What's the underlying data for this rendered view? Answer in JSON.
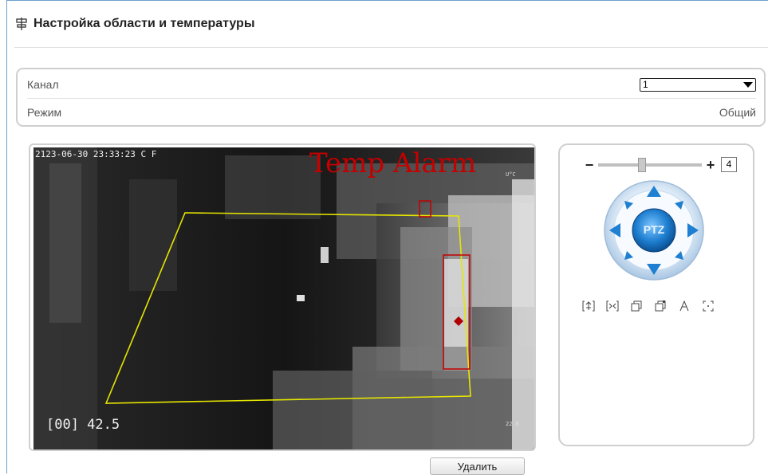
{
  "page": {
    "title": "Настройка области и температуры"
  },
  "settings": {
    "channel_label": "Канал",
    "channel_value": "1",
    "mode_label": "Режим",
    "mode_value": "Общий"
  },
  "video": {
    "timestamp": "2123-06-30 23:33:23 C F",
    "alarm_text": "Temp Alarm",
    "reading": "[00] 42.5",
    "corner_small_top": "U°C",
    "corner_small_bottom": "22.8"
  },
  "ptz": {
    "zoom_minus": "−",
    "zoom_plus": "+",
    "zoom_value": "4",
    "center_label": "PTZ",
    "tools": [
      "zoom-in-icon",
      "zoom-out-icon",
      "window-icon",
      "window-alt-icon",
      "font-icon",
      "focus-icon"
    ]
  },
  "actions": {
    "delete_label": "Удалить"
  },
  "colors": {
    "accent": "#6a9fd0",
    "polygon": "#e6e600",
    "alarm": "#c40000",
    "ptz_blue": "#1f7fd0"
  }
}
